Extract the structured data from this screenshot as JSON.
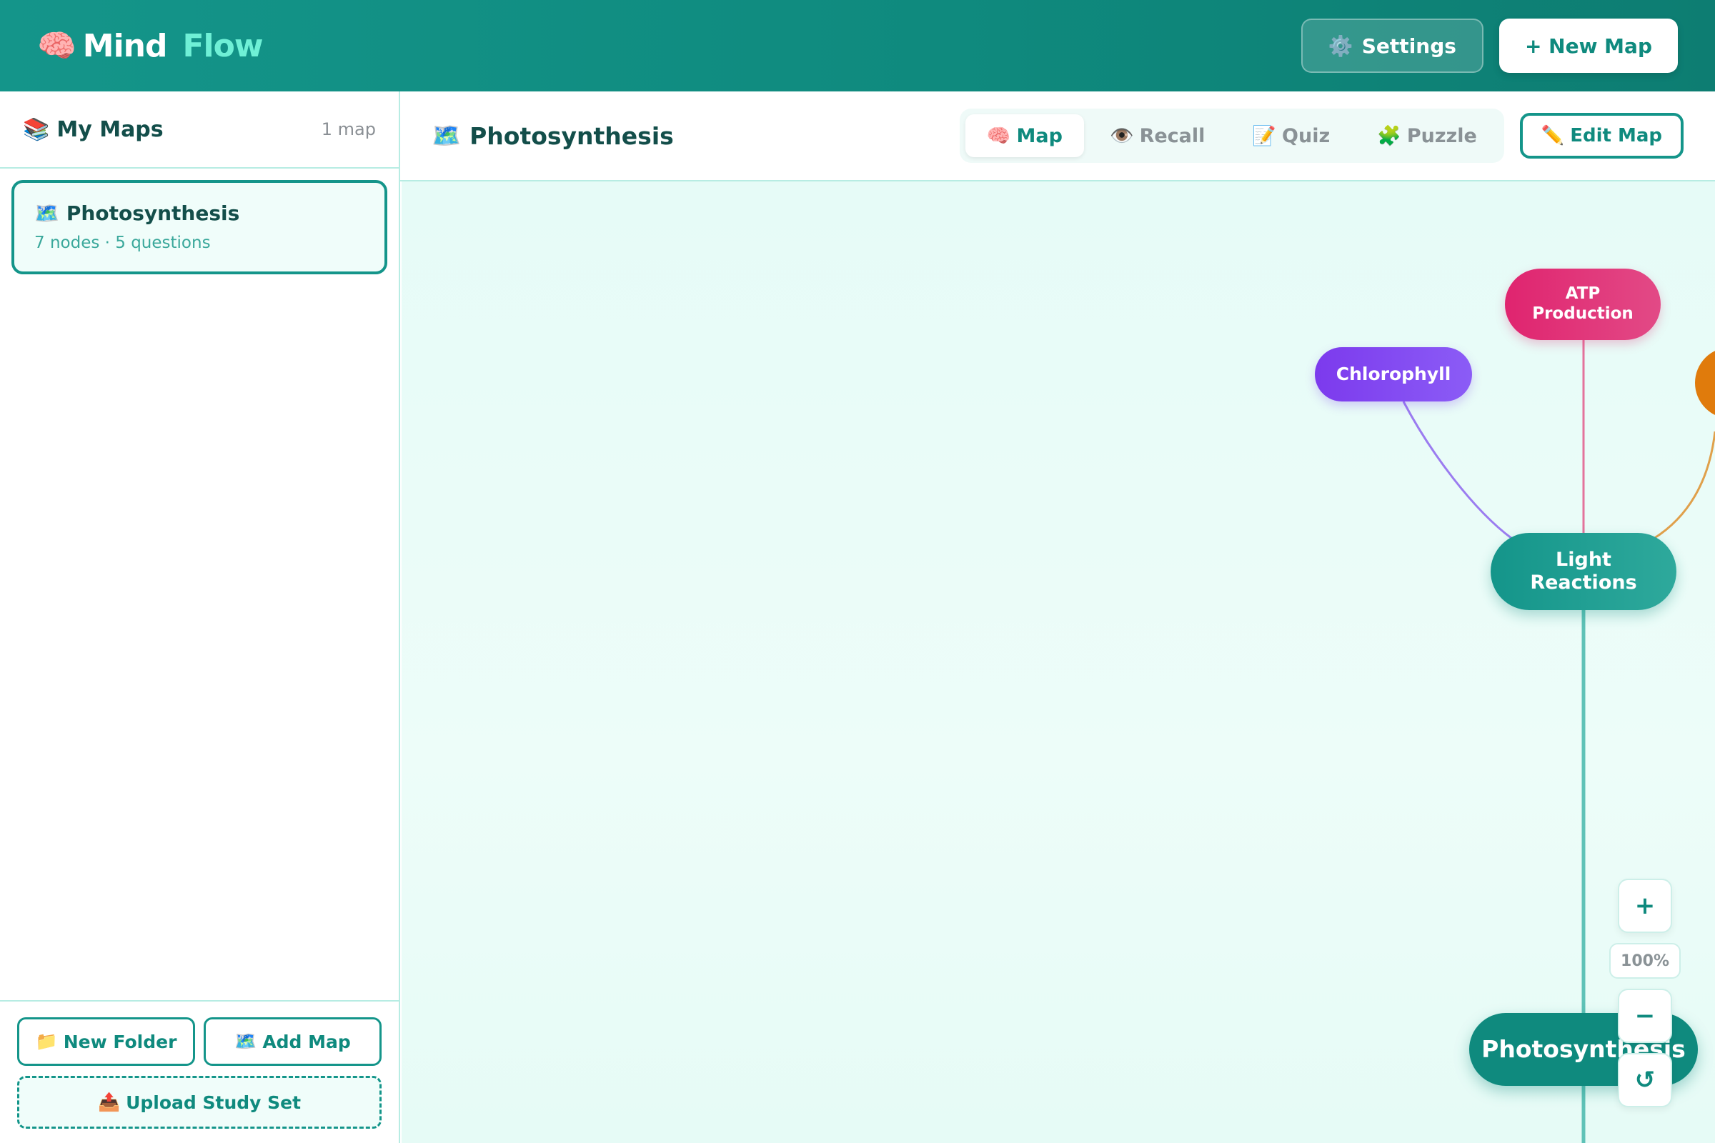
{
  "header": {
    "logo_icon": "🧠",
    "brand_primary": "Mind",
    "brand_accent": "Flow",
    "settings_icon": "⚙️",
    "settings_label": "Settings",
    "new_map_label": "+ New Map"
  },
  "sidebar": {
    "title_icon": "📚",
    "title": "My Maps",
    "count": "1 map",
    "maps": [
      {
        "icon": "🗺️",
        "title": "Photosynthesis",
        "meta": "7 nodes · 5 questions"
      }
    ],
    "new_folder_icon": "📁",
    "new_folder_label": "New Folder",
    "add_map_icon": "🗺️",
    "add_map_label": "Add Map",
    "upload_icon": "📤",
    "upload_label": "Upload Study Set"
  },
  "main": {
    "title_icon": "🗺️",
    "title": "Photosynthesis",
    "tabs": [
      {
        "icon": "🧠",
        "label": "Map",
        "active": true
      },
      {
        "icon": "👁️",
        "label": "Recall",
        "active": false
      },
      {
        "icon": "📝",
        "label": "Quiz",
        "active": false
      },
      {
        "icon": "🧩",
        "label": "Puzzle",
        "active": false
      }
    ],
    "edit_icon": "✏️",
    "edit_label": "Edit Map"
  },
  "canvas": {
    "nodes": {
      "atp": "ATP\nProduction",
      "chlorophyll": "Chlorophyll",
      "light_reactions": "Light\nReactions",
      "root": "Photosynthesis"
    },
    "colors": {
      "root": "#0f8a7e",
      "light_reactions": "#14958a",
      "atp": "#e0246f",
      "chlorophyll": "#7c3aed",
      "orange_branch": "#e07b0c"
    },
    "zoom": {
      "in_label": "+",
      "level": "100%",
      "out_label": "−",
      "reset_label": "↺"
    }
  }
}
